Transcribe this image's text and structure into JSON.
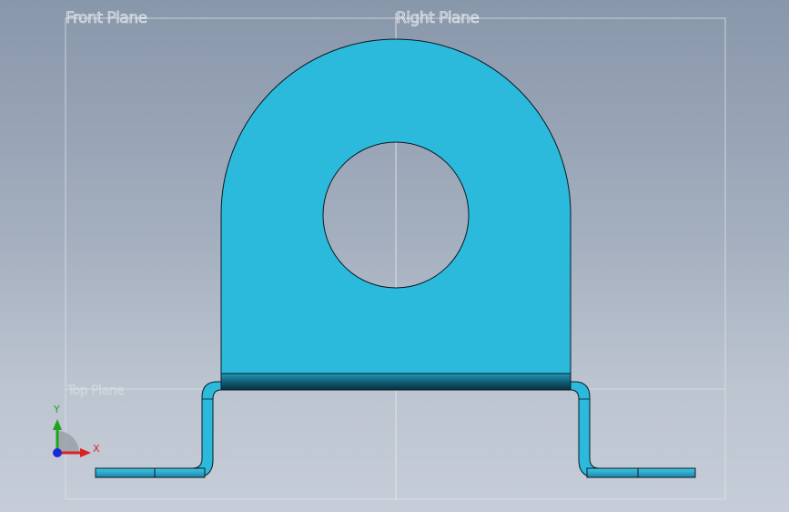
{
  "viewport": {
    "planes": {
      "front": "Front Plane",
      "right": "Right Plane",
      "top": "Top Plane"
    },
    "triad": {
      "x_label": "X",
      "y_label": "Y",
      "x_color": "#e02020",
      "y_color": "#1fa31f",
      "z_color": "#1a2ad8"
    },
    "part_color": "#2bbadc",
    "edge_color": "#0a1a22"
  }
}
